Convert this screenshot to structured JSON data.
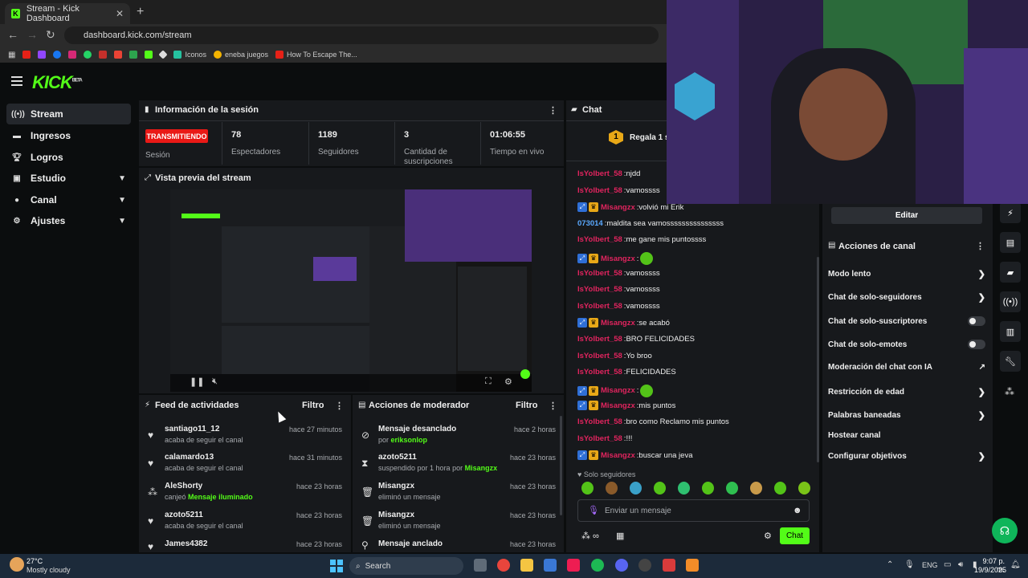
{
  "browser": {
    "tab_title": "Stream - Kick Dashboard",
    "url": "dashboard.kick.com/stream",
    "bookmarks": [
      "Iconos",
      "eneba juegos",
      "How To Escape The..."
    ]
  },
  "header": {
    "logo": "KICK",
    "logo_badge": "BETA"
  },
  "sidebar": {
    "items": [
      {
        "label": "Stream",
        "icon": "broadcast-icon"
      },
      {
        "label": "Ingresos",
        "icon": "wallet-icon"
      },
      {
        "label": "Logros",
        "icon": "trophy-icon"
      },
      {
        "label": "Estudio",
        "icon": "camera-icon"
      },
      {
        "label": "Canal",
        "icon": "user-icon"
      },
      {
        "label": "Ajustes",
        "icon": "gear-icon"
      }
    ]
  },
  "session": {
    "title": "Información de la sesión",
    "status": "TRANSMITIENDO",
    "status_label": "Sesión",
    "stats": [
      {
        "value": "78",
        "label": "Espectadores"
      },
      {
        "value": "1189",
        "label": "Seguidores"
      },
      {
        "value": "3",
        "label": "Cantidad de suscripciones"
      },
      {
        "value": "01:06:55",
        "label": "Tiempo en vivo"
      }
    ]
  },
  "preview": {
    "title": "Vista previa del stream"
  },
  "feed": {
    "title": "Feed de actividades",
    "filter": "Filtro",
    "items": [
      {
        "name": "santiago11_12",
        "sub": "acaba de seguir el canal",
        "highlight": "",
        "time": "hace 27 minutos",
        "icon": "heart-icon"
      },
      {
        "name": "calamardo13",
        "sub": "acaba de seguir el canal",
        "highlight": "",
        "time": "hace 31 minutos",
        "icon": "heart-icon"
      },
      {
        "name": "AleShorty",
        "sub": "canjeó",
        "highlight": "Mensaje iluminado",
        "time": "hace 23 horas",
        "icon": "points-icon"
      },
      {
        "name": "azoto5211",
        "sub": "acaba de seguir el canal",
        "highlight": "",
        "time": "hace 23 horas",
        "icon": "heart-icon"
      },
      {
        "name": "James4382",
        "sub": "",
        "highlight": "",
        "time": "hace 23 horas",
        "icon": "heart-icon"
      }
    ]
  },
  "moderator": {
    "title": "Acciones de moderador",
    "filter": "Filtro",
    "items": [
      {
        "name": "Mensaje desanclado",
        "sub": "por",
        "highlight": "eriksonlop",
        "time": "hace 2 horas",
        "icon": "unpin-icon"
      },
      {
        "name": "azoto5211",
        "sub": "suspendido por 1 hora por",
        "highlight": "Misangzx",
        "time": "hace 23 horas",
        "icon": "hourglass-icon"
      },
      {
        "name": "Misangzx",
        "sub": "eliminó un mensaje",
        "highlight": "",
        "time": "hace 23 horas",
        "icon": "trash-icon"
      },
      {
        "name": "Misangzx",
        "sub": "eliminó un mensaje",
        "highlight": "",
        "time": "hace 23 horas",
        "icon": "trash-icon"
      },
      {
        "name": "Mensaje anclado",
        "sub": "",
        "highlight": "",
        "time": "hace 23 horas",
        "icon": "pin-icon"
      }
    ]
  },
  "chat": {
    "title": "Chat",
    "gift_banner": "Regala 1 su",
    "messages": [
      {
        "user": "IsYolbert_58",
        "text": "njdd",
        "color": "#e0245e",
        "badges": false,
        "emote": false
      },
      {
        "user": "IsYolbert_58",
        "text": "vamossss",
        "color": "#e0245e",
        "badges": false,
        "emote": false
      },
      {
        "user": "Misangzx",
        "text": "volvió mi Erik",
        "color": "#e0245e",
        "badges": true,
        "emote": false
      },
      {
        "user": "073014",
        "text": "maldita sea vamosssssssssssssss",
        "color": "#5aa9ff",
        "badges": false,
        "emote": false
      },
      {
        "user": "IsYolbert_58",
        "text": "me gane mis puntossss",
        "color": "#e0245e",
        "badges": false,
        "emote": false
      },
      {
        "user": "Misangzx",
        "text": "",
        "color": "#e0245e",
        "badges": true,
        "emote": true
      },
      {
        "user": "IsYolbert_58",
        "text": "vamossss",
        "color": "#e0245e",
        "badges": false,
        "emote": false
      },
      {
        "user": "IsYolbert_58",
        "text": "vamossss",
        "color": "#e0245e",
        "badges": false,
        "emote": false
      },
      {
        "user": "IsYolbert_58",
        "text": "vamossss",
        "color": "#e0245e",
        "badges": false,
        "emote": false
      },
      {
        "user": "Misangzx",
        "text": "se acabó",
        "color": "#e0245e",
        "badges": true,
        "emote": false
      },
      {
        "user": "IsYolbert_58",
        "text": "BRO FELICIDADES",
        "color": "#e0245e",
        "badges": false,
        "emote": false
      },
      {
        "user": "IsYolbert_58",
        "text": "Yo broo",
        "color": "#e0245e",
        "badges": false,
        "emote": false
      },
      {
        "user": "IsYolbert_58",
        "text": "FELICIDADES",
        "color": "#e0245e",
        "badges": false,
        "emote": false
      },
      {
        "user": "Misangzx",
        "text": "",
        "color": "#e0245e",
        "badges": true,
        "emote": true
      },
      {
        "user": "Misangzx",
        "text": "mis puntos",
        "color": "#e0245e",
        "badges": true,
        "emote": false
      },
      {
        "user": "IsYolbert_58",
        "text": "bro como Reclamo mis puntos",
        "color": "#e0245e",
        "badges": false,
        "emote": false
      },
      {
        "user": "IsYolbert_58",
        "text": "!!!",
        "color": "#e0245e",
        "badges": false,
        "emote": false
      },
      {
        "user": "Misangzx",
        "text": "buscar una jeva",
        "color": "#e0245e",
        "badges": true,
        "emote": false
      }
    ],
    "followers_only": "Solo seguidores",
    "input_placeholder": "Enviar un mensaje",
    "send_label": "Chat"
  },
  "channel_actions": {
    "edit_label": "Editar",
    "title": "Acciones de canal",
    "items": [
      {
        "label": "Modo lento",
        "control": "chevron"
      },
      {
        "label": "Chat de solo-seguidores",
        "control": "chevron"
      },
      {
        "label": "Chat de solo-suscriptores",
        "control": "toggle"
      },
      {
        "label": "Chat de solo-emotes",
        "control": "toggle"
      },
      {
        "label": "Moderación del chat con IA",
        "control": "external"
      },
      {
        "label": "Restricción de edad",
        "control": "chevron"
      },
      {
        "label": "Palabras baneadas",
        "control": "chevron"
      },
      {
        "label": "Hostear canal",
        "control": "none"
      },
      {
        "label": "Configurar objetivos",
        "control": "chevron"
      }
    ]
  },
  "taskbar": {
    "weather_temp": "27°C",
    "weather_desc": "Mostly cloudy",
    "search": "Search",
    "lang": "ENG",
    "time": "9:07 p. m.",
    "date": "19/9/2025"
  },
  "colors": {
    "accent": "#53fc18",
    "live": "#e91916",
    "panel": "#17191c"
  }
}
